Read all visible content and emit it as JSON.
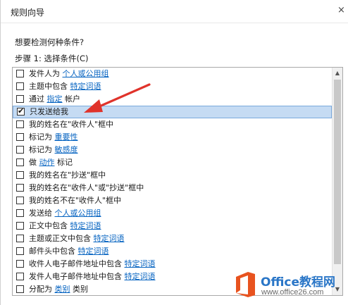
{
  "window": {
    "title": "规则向导",
    "close_glyph": "×"
  },
  "question": "想要检测何种条件?",
  "step": "步骤 1: 选择条件(C)",
  "conditions": [
    {
      "checked": false,
      "parts": [
        {
          "t": "发件人为 "
        },
        {
          "t": "个人或公用组",
          "link": true
        }
      ]
    },
    {
      "checked": false,
      "parts": [
        {
          "t": "主题中包含 "
        },
        {
          "t": "特定词语",
          "link": true
        }
      ]
    },
    {
      "checked": false,
      "parts": [
        {
          "t": "通过 "
        },
        {
          "t": "指定",
          "link": true
        },
        {
          "t": " 帐户"
        }
      ]
    },
    {
      "checked": true,
      "selected": true,
      "parts": [
        {
          "t": "只发送给我"
        }
      ]
    },
    {
      "checked": false,
      "parts": [
        {
          "t": "我的姓名在\"收件人\"框中"
        }
      ]
    },
    {
      "checked": false,
      "parts": [
        {
          "t": "标记为 "
        },
        {
          "t": "重要性",
          "link": true
        }
      ]
    },
    {
      "checked": false,
      "parts": [
        {
          "t": "标记为 "
        },
        {
          "t": "敏感度",
          "link": true
        }
      ]
    },
    {
      "checked": false,
      "parts": [
        {
          "t": "做 "
        },
        {
          "t": "动作",
          "link": true
        },
        {
          "t": " 标记"
        }
      ]
    },
    {
      "checked": false,
      "parts": [
        {
          "t": "我的姓名在\"抄送\"框中"
        }
      ]
    },
    {
      "checked": false,
      "parts": [
        {
          "t": "我的姓名在\"收件人\"或\"抄送\"框中"
        }
      ]
    },
    {
      "checked": false,
      "parts": [
        {
          "t": "我的姓名不在\"收件人\"框中"
        }
      ]
    },
    {
      "checked": false,
      "parts": [
        {
          "t": "发送给 "
        },
        {
          "t": "个人或公用组",
          "link": true
        }
      ]
    },
    {
      "checked": false,
      "parts": [
        {
          "t": "正文中包含 "
        },
        {
          "t": "特定词语",
          "link": true
        }
      ]
    },
    {
      "checked": false,
      "parts": [
        {
          "t": "主题或正文中包含 "
        },
        {
          "t": "特定词语",
          "link": true
        }
      ]
    },
    {
      "checked": false,
      "parts": [
        {
          "t": "邮件头中包含 "
        },
        {
          "t": "特定词语",
          "link": true
        }
      ]
    },
    {
      "checked": false,
      "parts": [
        {
          "t": "收件人电子邮件地址中包含 "
        },
        {
          "t": "特定词语",
          "link": true
        }
      ]
    },
    {
      "checked": false,
      "parts": [
        {
          "t": "发件人电子邮件地址中包含 "
        },
        {
          "t": "特定词语",
          "link": true
        }
      ]
    },
    {
      "checked": false,
      "parts": [
        {
          "t": "分配为 "
        },
        {
          "t": "类别",
          "link": true
        },
        {
          "t": " 类别"
        }
      ]
    }
  ],
  "annotation": {
    "color": "#e0332b"
  },
  "watermark": {
    "title": "Office教程网",
    "url": "www.office26.com",
    "logo_color": "#e8531f"
  },
  "colors": {
    "link": "#0563c1",
    "selection": "#c5dbf3"
  }
}
